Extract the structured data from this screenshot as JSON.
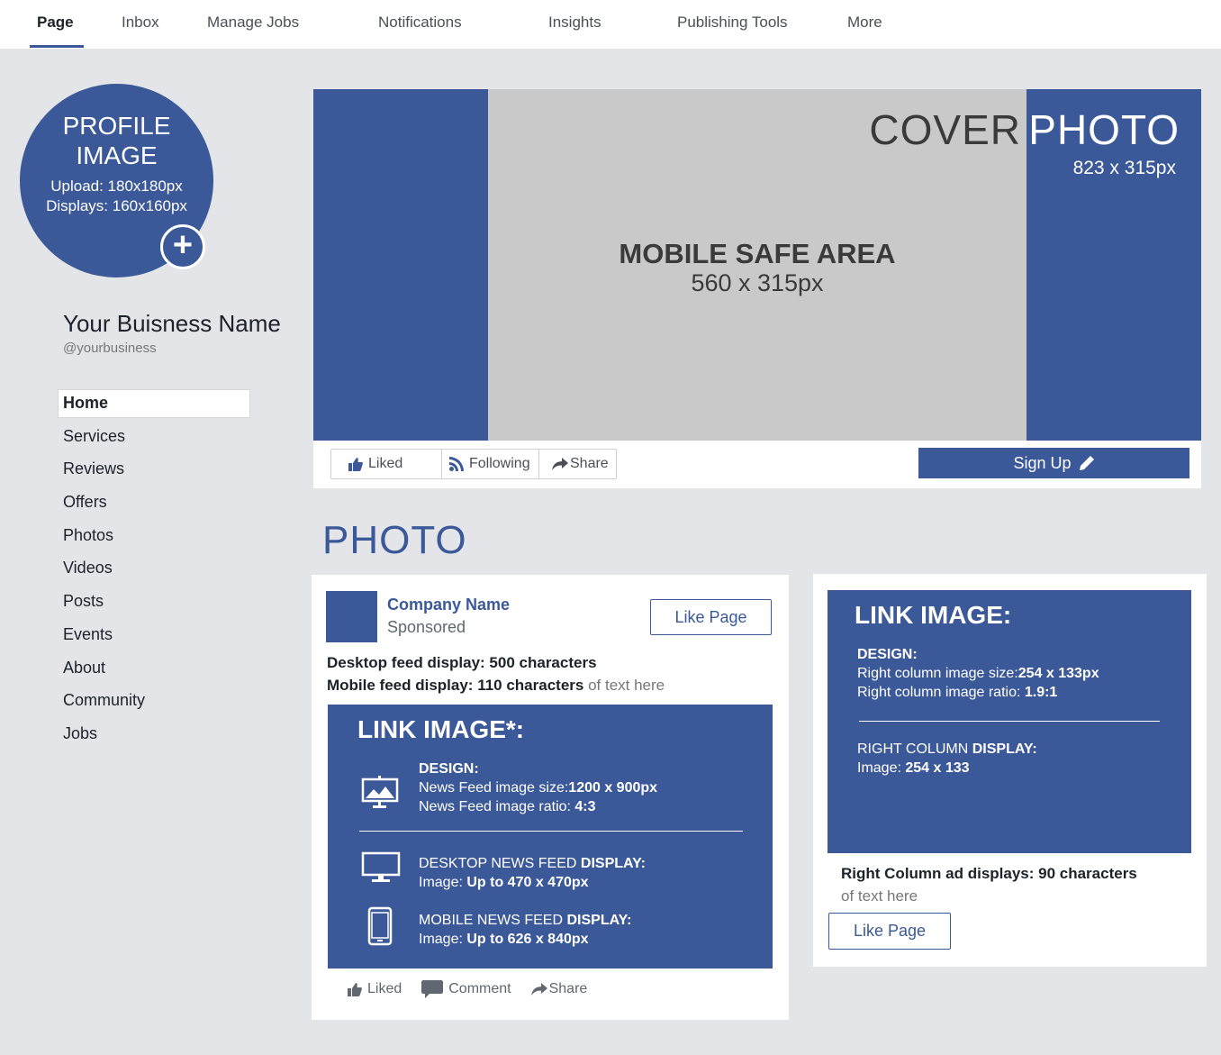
{
  "nav": {
    "tabs": [
      "Page",
      "Inbox",
      "Manage Jobs",
      "Notifications",
      "Insights",
      "Publishing Tools",
      "More"
    ],
    "active": "Page"
  },
  "profile": {
    "title": "PROFILE\nIMAGE",
    "upload": "Upload: 180x180px",
    "displays": "Displays: 160x160px",
    "add_icon": "plus-icon"
  },
  "business": {
    "name": "Your Buisness Name",
    "handle": "@yourbusiness"
  },
  "sidebar": {
    "items": [
      "Home",
      "Services",
      "Reviews",
      "Offers",
      "Photos",
      "Videos",
      "Posts",
      "Events",
      "About",
      "Community",
      "Jobs"
    ],
    "active": "Home"
  },
  "cover": {
    "title_part1": "COVER",
    "title_part2": "PHOTO",
    "dimensions": "823 x 315px",
    "safe_area_title": "MOBILE SAFE AREA",
    "safe_area_dimensions": "560 x 315px"
  },
  "actions": {
    "liked": "Liked",
    "following": "Following",
    "share": "Share",
    "signup": "Sign Up"
  },
  "photo_heading": "PHOTO",
  "post": {
    "company": "Company Name",
    "sponsored": "Sponsored",
    "like_page": "Like Page",
    "desktop_line": "Desktop feed display: 500 characters",
    "mobile_line_bold": "Mobile feed display: 110 characters",
    "mobile_line_rest": " of text here",
    "link_image_title": "LINK IMAGE*:",
    "design_label": "DESIGN:",
    "design_size_label": "News Feed image size:",
    "design_size_value": "1200 x 900px",
    "design_ratio_label": "News Feed image ratio: ",
    "design_ratio_value": "4:3",
    "desktop_display_label": "DESKTOP NEWS FEED ",
    "desktop_display_bold": "DISPLAY:",
    "desktop_image_label": "Image: ",
    "desktop_image_value": "Up to 470 x 470px",
    "mobile_display_label": "MOBILE NEWS FEED ",
    "mobile_display_bold": "DISPLAY:",
    "mobile_image_label": "Image: ",
    "mobile_image_value": "Up to 626 x 840px",
    "footer": {
      "liked": "Liked",
      "comment": "Comment",
      "share": "Share"
    }
  },
  "right_ad": {
    "title": "LINK IMAGE:",
    "design_label": "DESIGN:",
    "size_label": "Right column image size:",
    "size_value": "254 x 133px",
    "ratio_label": "Right column image ratio: ",
    "ratio_value": "1.9:1",
    "display_label": "RIGHT COLUMN ",
    "display_bold": "DISPLAY:",
    "image_label": "Image: ",
    "image_value": "254 x 133",
    "caption_bold": "Right Column ad displays: 90 characters",
    "caption_rest": "of text here",
    "like_page": "Like Page"
  },
  "colors": {
    "brand": "#3b5998",
    "safe_area": "#c9c9c9",
    "page_bg": "#e3e5e9"
  }
}
